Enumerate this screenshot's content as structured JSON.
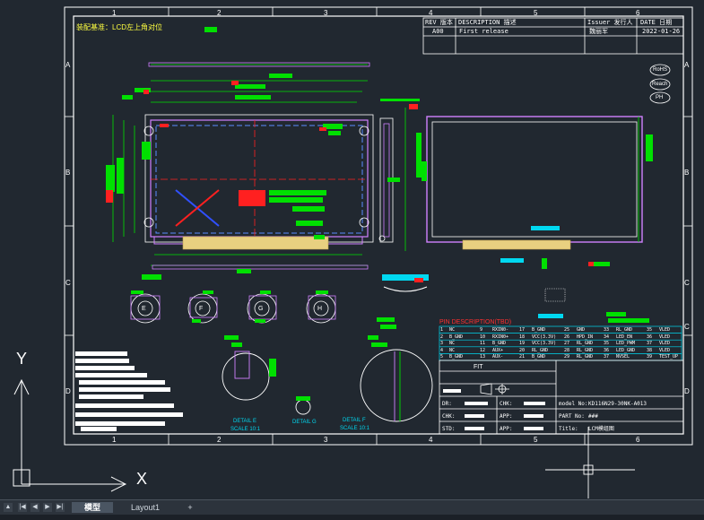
{
  "frame": {
    "col_numbers": [
      "1",
      "2",
      "3",
      "4",
      "5",
      "6"
    ],
    "row_letters": [
      "A",
      "B",
      "C",
      "D"
    ]
  },
  "notes": {
    "assembly_note": "装配基准：LCD左上角对位"
  },
  "revision_table": {
    "rev_header": "REV 版本",
    "desc_header": "DESCRIPTION 描述",
    "issuer_header": "Issuer 发行人",
    "date_header": "DATE 日期",
    "rev": "A00",
    "description": "First release",
    "issuer": "魏丽军",
    "date": "2022-01-26"
  },
  "badges": [
    "RoHS",
    "Reach",
    "PH"
  ],
  "pin_table": {
    "title": "PIN DESCRIPTION(TBD)",
    "rows": [
      [
        "1",
        "NC",
        "9",
        "RXIN0-",
        "17",
        "B_GND",
        "25",
        "GND",
        "33",
        "RL_GND",
        "35",
        "VLED"
      ],
      [
        "2",
        "B_GND",
        "10",
        "RXIN0+",
        "18",
        "VCC(3.3V)",
        "26",
        "HPD_IN",
        "34",
        "LED_EN",
        "36",
        "VLED"
      ],
      [
        "3",
        "NC",
        "11",
        "B_GND",
        "19",
        "VCC(3.3V)",
        "27",
        "RL_GND",
        "35",
        "LED_PWM",
        "37",
        "VLED"
      ],
      [
        "4",
        "NC",
        "12",
        "AUX+",
        "20",
        "RL_GND",
        "28",
        "RL_GND",
        "36",
        "LED_GND",
        "38",
        "VLED"
      ],
      [
        "5",
        "B_GND",
        "13",
        "AUX-",
        "21",
        "B_GND",
        "29",
        "RL_GND",
        "37",
        "NVSEL",
        "39",
        "TEST_UP"
      ]
    ]
  },
  "title_block": {
    "fit_label": "FIT",
    "model_label": "model No:",
    "model_value": "KD116N29-30NK-A013",
    "part_label": "PART No:",
    "part_value": "###",
    "title_label": "Title:",
    "title_value": "LCM模组图",
    "row_labels": [
      "DR:",
      "CHK:",
      "STD:"
    ],
    "row_labels2": [
      "CHK:",
      "APP:",
      "APP:"
    ]
  },
  "details": {
    "detail_e": "DETAIL E",
    "scale_e": "SCALE 10:1",
    "detail_g": "DETAIL G",
    "detail_f": "DETAIL F",
    "scale_f": "SCALE 10:1"
  },
  "callouts": {
    "letters": [
      "E",
      "F",
      "G",
      "H"
    ]
  },
  "ucs": {
    "x_label": "X",
    "y_label": "Y"
  },
  "layout_tabs": {
    "nav": [
      "▲",
      "|◀",
      "◀",
      "▶",
      "▶|"
    ],
    "model": "模型",
    "layout1": "Layout1",
    "add": "+"
  },
  "colors": {
    "background": "#212830",
    "frame": "#ffffff",
    "dimension": "#00e000",
    "highlight": "#ff2020",
    "cyan": "#00d8f0",
    "outline_purple": "#d080ff",
    "fpc_yellow": "#e8d080",
    "table_red": "#ff3030"
  }
}
